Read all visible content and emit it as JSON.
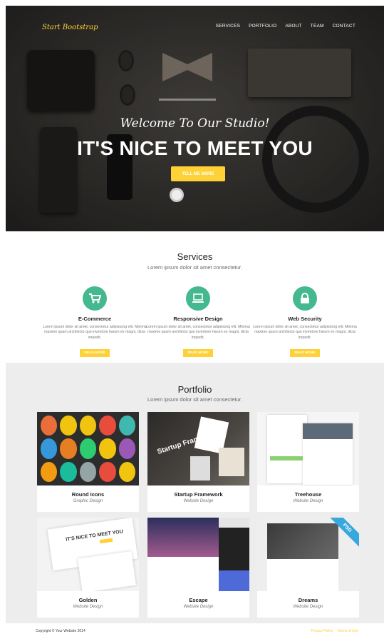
{
  "header": {
    "brand": "Start Bootstrap",
    "nav": [
      "SERVICES",
      "PORTFOLIO",
      "ABOUT",
      "TEAM",
      "CONTACT"
    ]
  },
  "hero": {
    "welcome": "Welcome To Our Studio!",
    "headline": "IT'S NICE TO MEET YOU",
    "cta_label": "TELL ME MORE"
  },
  "services": {
    "title": "Services",
    "subtitle": "Lorem ipsum dolor sit amet consectetur.",
    "items": [
      {
        "title": "E-Commerce",
        "icon": "shopping-cart-icon",
        "text": "Lorem ipsum dolor sit amet, consectetur adipisicing elit. Minima maxime quam architecto quo inventore harum ex magni, dicta impedit.",
        "button": "READ MORE"
      },
      {
        "title": "Responsive Design",
        "icon": "laptop-icon",
        "text": "Lorem ipsum dolor sit amet, consectetur adipisicing elit. Minima maxime quam architecto quo inventore harum ex magni, dicta impedit.",
        "button": "READ MORE"
      },
      {
        "title": "Web Security",
        "icon": "lock-icon",
        "text": "Lorem ipsum dolor sit amet, consectetur adipisicing elit. Minima maxime quam architecto quo inventore harum ex magni, dicta impedit.",
        "button": "READ MORE"
      }
    ]
  },
  "portfolio": {
    "title": "Portfolio",
    "subtitle": "Lorem ipsum dolor sit amet consectetur.",
    "items": [
      {
        "title": "Round Icons",
        "category": "Graphic Design"
      },
      {
        "title": "Startup Framework",
        "category": "Website Design",
        "image_text": "Startup Framework"
      },
      {
        "title": "Treehouse",
        "category": "Website Design"
      },
      {
        "title": "Golden",
        "category": "Website Design",
        "image_text": "IT'S NICE TO MEET YOU"
      },
      {
        "title": "Escape",
        "category": "Website Design"
      },
      {
        "title": "Dreams",
        "category": "Website Design",
        "badge": "PSD"
      }
    ]
  },
  "footer": {
    "copyright": "Copyright © Your Website 2014",
    "links": [
      "Privacy Policy",
      "Terms of Use"
    ]
  },
  "colors": {
    "accent": "#fed136",
    "service_icon": "#44b88f",
    "ribbon": "#37a8dc"
  }
}
